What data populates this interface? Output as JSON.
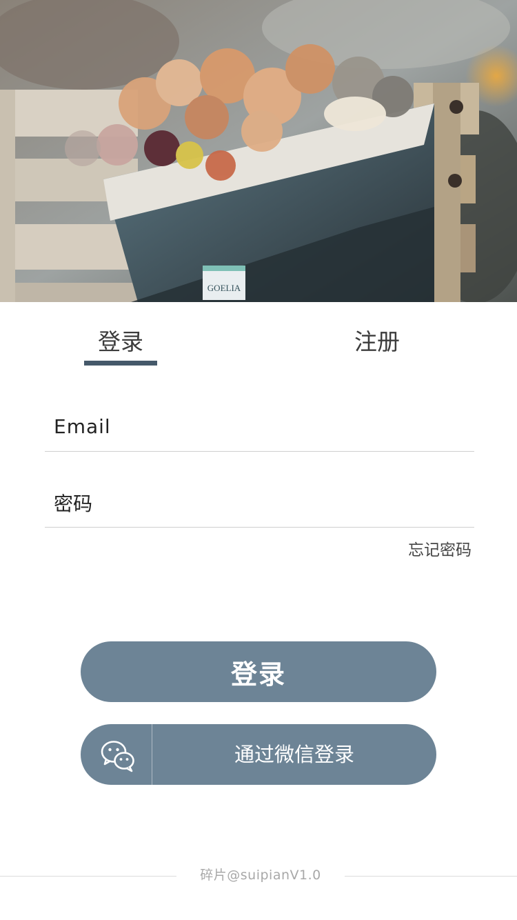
{
  "hero": {
    "image": "dried-flower-bouquet-photo",
    "tag_text": "GOELIA"
  },
  "tabs": [
    {
      "label": "登录",
      "active": true
    },
    {
      "label": "注册",
      "active": false
    }
  ],
  "form": {
    "email_placeholder": "Email",
    "password_placeholder": "密码",
    "forgot_password": "忘记密码"
  },
  "buttons": {
    "login_label": "登录",
    "wechat_label": "通过微信登录",
    "wechat_icon": "wechat-icon"
  },
  "footer": {
    "version_text": "碎片@suipianV1.0"
  },
  "colors": {
    "accent": "#6d8496",
    "tab_indicator": "#45596a",
    "divider": "#cfcfcf",
    "footer_text": "#a8a8a8"
  }
}
